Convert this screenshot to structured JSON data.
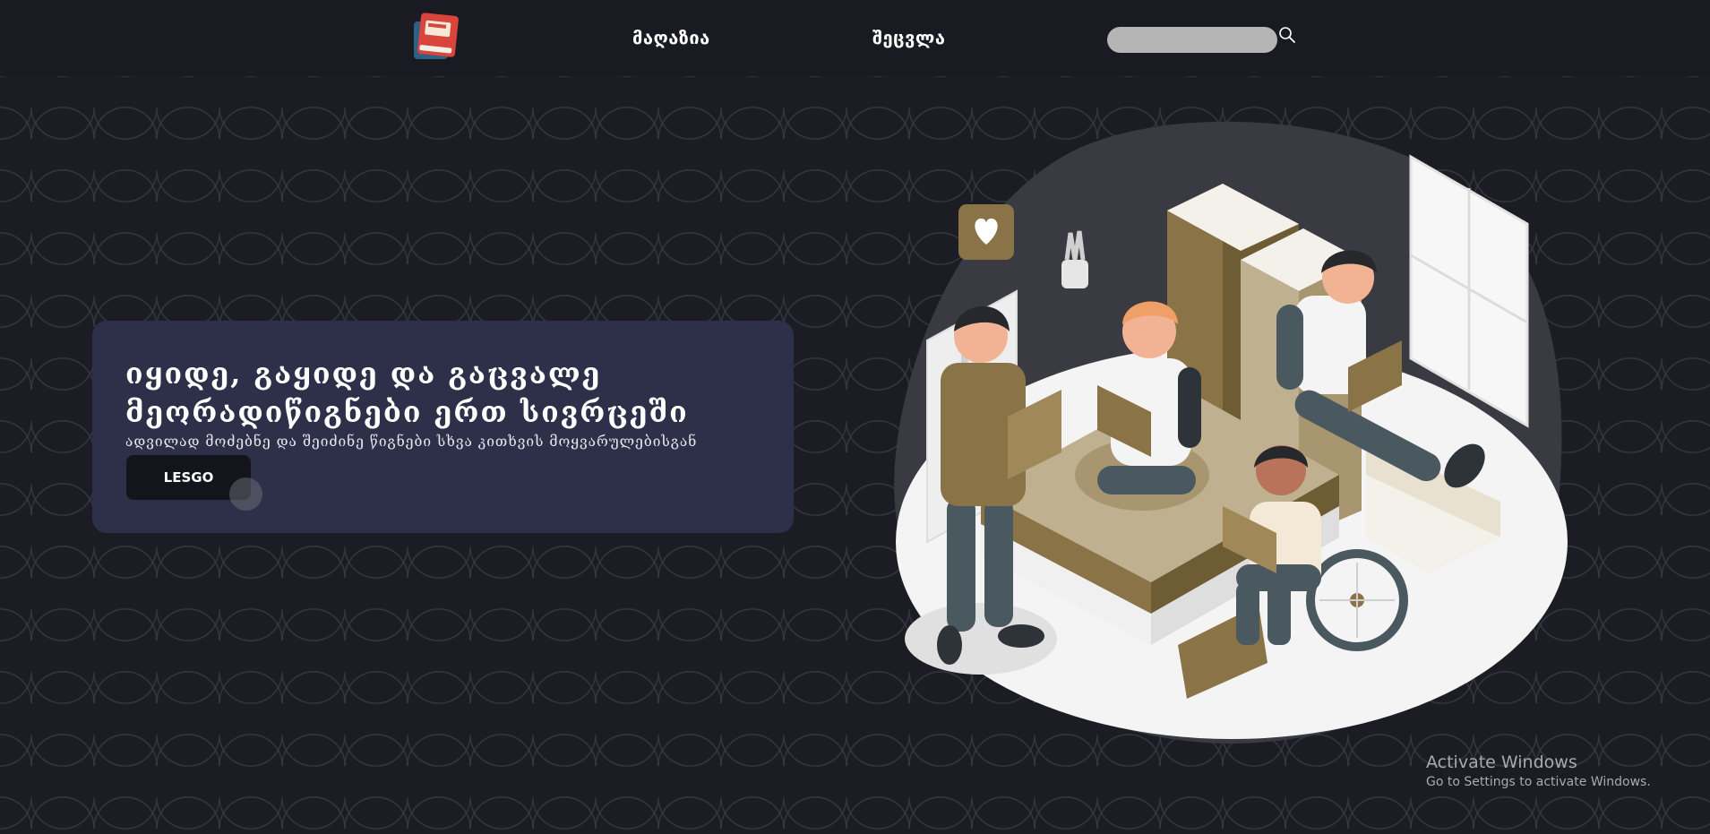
{
  "header": {
    "nav": [
      {
        "label": "მაღაზია"
      },
      {
        "label": "შეცვლა"
      }
    ],
    "search": {
      "placeholder": "",
      "value": "",
      "icon": "search-icon"
    }
  },
  "hero": {
    "title_line1": "იყიდე, გაყიდე და გაცვალე",
    "title_line2": "მეორადიწიგნები ერთ სივრცეში",
    "subtitle": "ადვილად მოძებნე და შეიძინე წიგნები სხვა კითხვის მოყვარულებისგან",
    "cta_label": "LESGO"
  },
  "watermark": {
    "title": "Activate Windows",
    "subtitle": "Go to Settings to activate Windows."
  },
  "colors": {
    "background": "#1a1b22",
    "card": "#2d3048",
    "search_field": "#b5b5b5",
    "book_brown": "#8a7447",
    "book_red": "#d9453b"
  }
}
